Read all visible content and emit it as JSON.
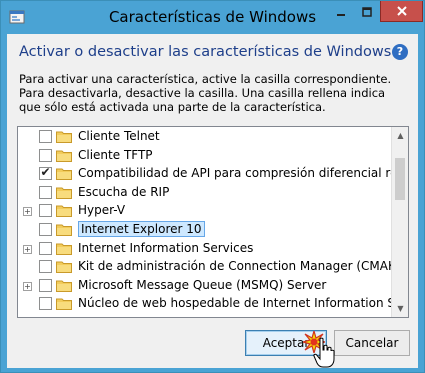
{
  "window": {
    "title": "Características de Windows"
  },
  "dialog": {
    "heading": "Activar o desactivar las características de Windows",
    "description": "Para activar una característica, active la casilla correspondiente. Para desactivarla, desactive la casilla. Una casilla rellena indica que sólo está activada una parte de la característica."
  },
  "features": [
    {
      "label": "Cliente Telnet",
      "checked": false,
      "expandable": false
    },
    {
      "label": "Cliente TFTP",
      "checked": false,
      "expandable": false
    },
    {
      "label": "Compatibilidad de API para compresión diferencial remota",
      "checked": true,
      "expandable": false
    },
    {
      "label": "Escucha de RIP",
      "checked": false,
      "expandable": false
    },
    {
      "label": "Hyper-V",
      "checked": false,
      "expandable": true
    },
    {
      "label": "Internet Explorer 10",
      "checked": false,
      "expandable": false,
      "selected": true
    },
    {
      "label": "Internet Information Services",
      "checked": false,
      "expandable": true
    },
    {
      "label": "Kit de administración de Connection Manager (CMAK) de RA",
      "checked": false,
      "expandable": false
    },
    {
      "label": "Microsoft Message Queue (MSMQ) Server",
      "checked": false,
      "expandable": true
    },
    {
      "label": "Núcleo de web hospedable de Internet Information Services",
      "checked": false,
      "expandable": false
    }
  ],
  "buttons": {
    "ok": "Aceptar",
    "cancel": "Cancelar"
  },
  "icons": {
    "help": "help-icon",
    "folder": "folder-icon",
    "minimize": "minimize-icon",
    "maximize": "maximize-icon",
    "close": "close-icon"
  },
  "colors": {
    "title_bar": "#4aa3d4",
    "heading": "#1e3f8a",
    "close_button": "#c7504b",
    "selection": "#cde8ff"
  }
}
